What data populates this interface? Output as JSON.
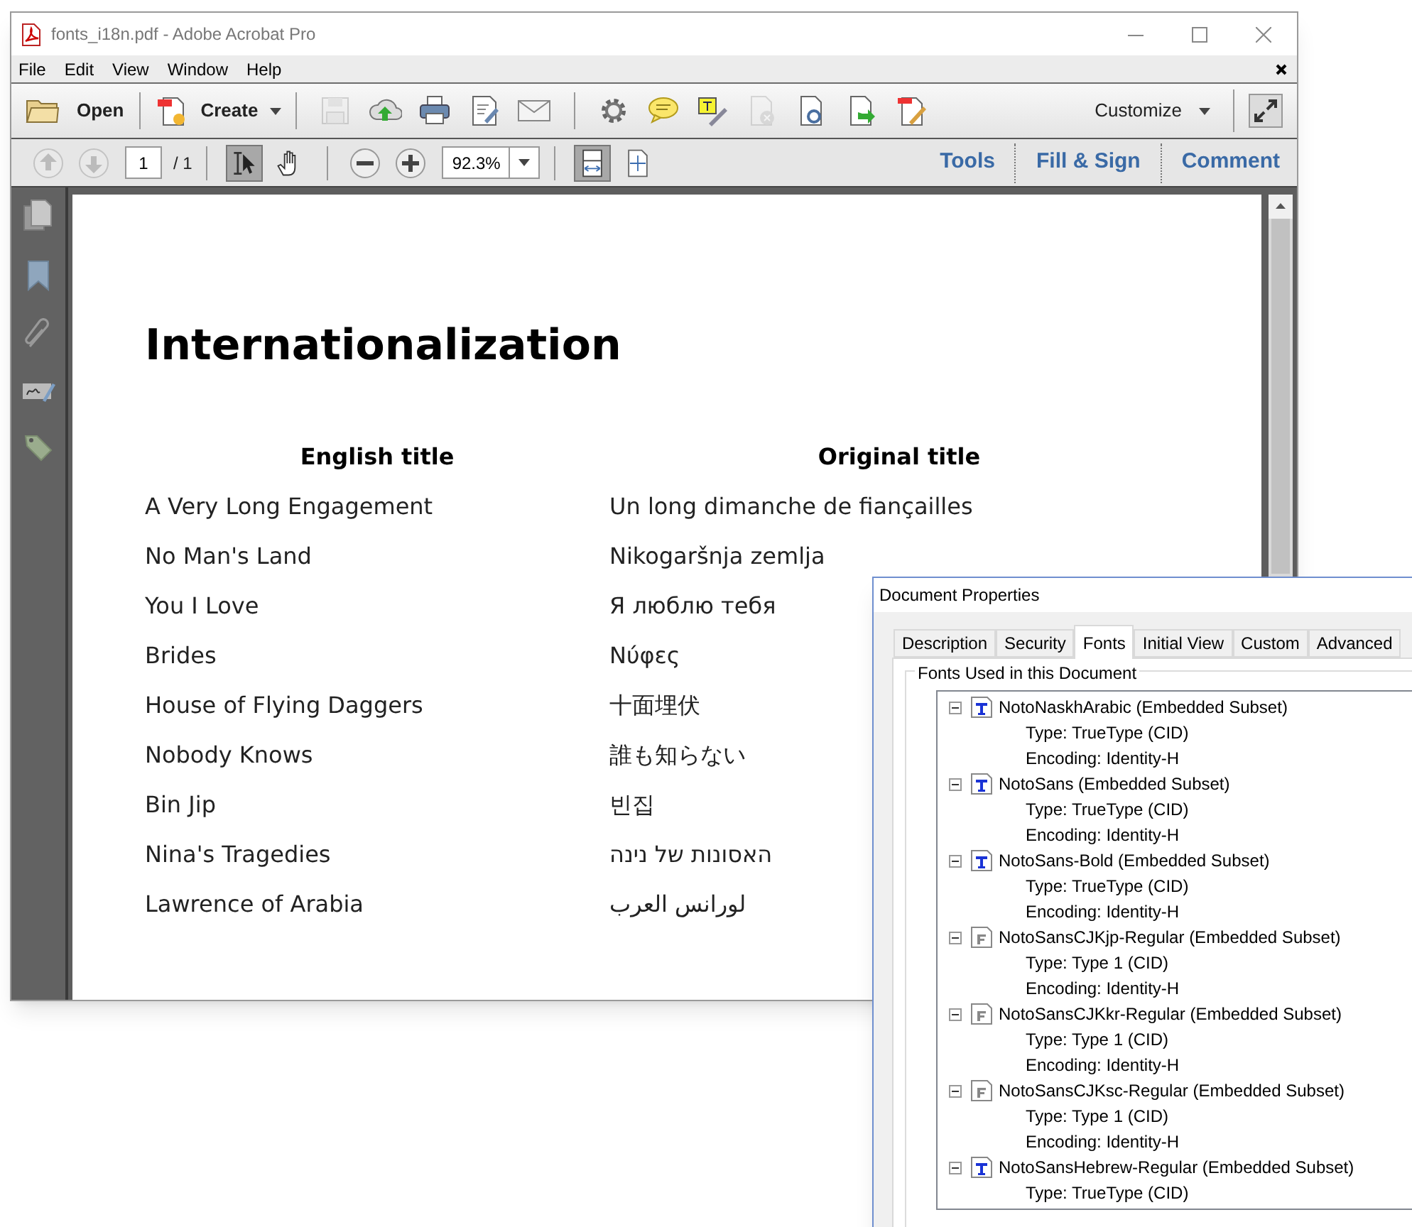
{
  "window": {
    "title": "fonts_i18n.pdf - Adobe Acrobat Pro"
  },
  "menu": [
    "File",
    "Edit",
    "View",
    "Window",
    "Help"
  ],
  "toolbar": {
    "open": "Open",
    "create": "Create",
    "customize": "Customize",
    "tools": [
      {
        "kind": "save",
        "disabled": true
      },
      {
        "kind": "upload",
        "disabled": false
      },
      {
        "kind": "print",
        "disabled": false
      },
      {
        "kind": "form",
        "disabled": false
      },
      {
        "kind": "mail",
        "disabled": false
      },
      {
        "kind": "gear",
        "disabled": false
      },
      {
        "kind": "comment",
        "disabled": false
      },
      {
        "kind": "highlight",
        "disabled": false
      },
      {
        "kind": "docx",
        "disabled": true
      },
      {
        "kind": "docscan",
        "disabled": false
      },
      {
        "kind": "docexport",
        "disabled": false
      },
      {
        "kind": "docedit",
        "disabled": false
      }
    ]
  },
  "navigation": {
    "prev_disabled": true,
    "next_disabled": true,
    "page": "1",
    "total": "/ 1",
    "zoom": "92.3%",
    "view_tools": [
      {
        "kind": "select",
        "selected": true
      },
      {
        "kind": "hand",
        "selected": false
      }
    ],
    "fit_tools": [
      {
        "kind": "fitwidth",
        "selected": true
      },
      {
        "kind": "fitpage",
        "selected": false
      }
    ],
    "panes": [
      "Tools",
      "Fill & Sign",
      "Comment"
    ]
  },
  "document": {
    "heading": "Internationalization",
    "columns": [
      "English title",
      "Original title"
    ],
    "rows": [
      {
        "english": "A Very Long Engagement",
        "original": "Un long dimanche de fiançailles"
      },
      {
        "english": "No Man's Land",
        "original": "Nikogaršnja zemlja"
      },
      {
        "english": "You I Love",
        "original": "Я люблю тебя"
      },
      {
        "english": "Brides",
        "original": "Νύφες"
      },
      {
        "english": "House of Flying Daggers",
        "original": "十面埋伏"
      },
      {
        "english": "Nobody Knows",
        "original": "誰も知らない"
      },
      {
        "english": "Bin Jip",
        "original": "빈집"
      },
      {
        "english": "Nina's Tragedies",
        "original": "האסונות של נינה"
      },
      {
        "english": "Lawrence of Arabia",
        "original": "لورانس العرب"
      }
    ]
  },
  "dialog": {
    "title": "Document Properties",
    "tabs": [
      {
        "label": "Description",
        "selected": false
      },
      {
        "label": "Security",
        "selected": false
      },
      {
        "label": "Fonts",
        "selected": true
      },
      {
        "label": "Initial View",
        "selected": false
      },
      {
        "label": "Custom",
        "selected": false
      },
      {
        "label": "Advanced",
        "selected": false
      }
    ],
    "group_label": "Fonts Used in this Document",
    "fonts": [
      {
        "name": "NotoNaskhArabic (Embedded Subset)",
        "kind": "truetype",
        "expanded": true,
        "details": [
          "Type: TrueType (CID)",
          "Encoding: Identity-H"
        ]
      },
      {
        "name": "NotoSans (Embedded Subset)",
        "kind": "truetype",
        "expanded": true,
        "details": [
          "Type: TrueType (CID)",
          "Encoding: Identity-H"
        ]
      },
      {
        "name": "NotoSans-Bold (Embedded Subset)",
        "kind": "truetype",
        "expanded": true,
        "details": [
          "Type: TrueType (CID)",
          "Encoding: Identity-H"
        ]
      },
      {
        "name": "NotoSansCJKjp-Regular (Embedded Subset)",
        "kind": "type1",
        "expanded": true,
        "details": [
          "Type: Type 1 (CID)",
          "Encoding: Identity-H"
        ]
      },
      {
        "name": "NotoSansCJKkr-Regular (Embedded Subset)",
        "kind": "type1",
        "expanded": true,
        "details": [
          "Type: Type 1 (CID)",
          "Encoding: Identity-H"
        ]
      },
      {
        "name": "NotoSansCJKsc-Regular (Embedded Subset)",
        "kind": "type1",
        "expanded": true,
        "details": [
          "Type: Type 1 (CID)",
          "Encoding: Identity-H"
        ]
      },
      {
        "name": "NotoSansHebrew-Regular (Embedded Subset)",
        "kind": "truetype",
        "expanded": true,
        "details": [
          "Type: TrueType (CID)"
        ]
      }
    ]
  }
}
